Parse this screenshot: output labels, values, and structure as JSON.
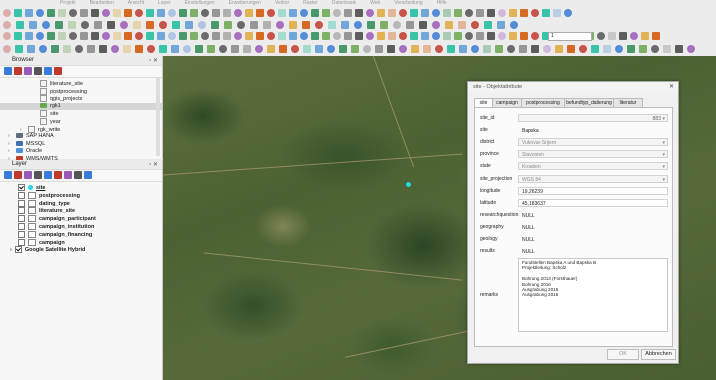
{
  "menu": [
    "Projekt",
    "Bearbeiten",
    "Ansicht",
    "Layer",
    "Einstellungen",
    "Erweiterungen",
    "Vektor",
    "Raster",
    "Datenbank",
    "Web",
    "Verarbeitung",
    "Hilfe"
  ],
  "toolbar": {
    "scale_value": "1"
  },
  "browser": {
    "title": "Browser",
    "items": [
      {
        "label": "literature_site",
        "indent": 2,
        "type": "table"
      },
      {
        "label": "postprocessing",
        "indent": 2,
        "type": "table"
      },
      {
        "label": "qgis_projects",
        "indent": 2,
        "type": "table"
      },
      {
        "label": "rgk1",
        "indent": 2,
        "type": "layer"
      },
      {
        "label": "site",
        "indent": 2,
        "type": "table"
      },
      {
        "label": "year",
        "indent": 2,
        "type": "table"
      },
      {
        "label": "rgk_write",
        "indent": 1,
        "type": "schema"
      },
      {
        "label": "SAP HANA",
        "indent": 0,
        "type": "db"
      },
      {
        "label": "MSSQL",
        "indent": 0,
        "type": "db"
      },
      {
        "label": "Oracle",
        "indent": 0,
        "type": "db"
      },
      {
        "label": "WMS/WMTS",
        "indent": 0,
        "type": "db"
      }
    ]
  },
  "layers": {
    "title": "Layer",
    "items": [
      {
        "label": "site",
        "checked": true,
        "highlight": true
      },
      {
        "label": "postprocessing",
        "checked": false
      },
      {
        "label": "dating_type",
        "checked": false
      },
      {
        "label": "literature_site",
        "checked": false
      },
      {
        "label": "campaign_participant",
        "checked": false
      },
      {
        "label": "campaign_institution",
        "checked": false
      },
      {
        "label": "campaign_financing",
        "checked": false
      },
      {
        "label": "campaign",
        "checked": false
      },
      {
        "label": "Google Satellite Hybrid",
        "checked": true
      }
    ]
  },
  "dialog": {
    "title": "site - Objektattribute",
    "tabs": [
      "site",
      "campaign",
      "postprocessing",
      "befundtyp_datierung",
      "literatur"
    ],
    "fields": [
      {
        "label": "site_id",
        "value": "",
        "id_value": "883",
        "kind": "ro"
      },
      {
        "label": "site",
        "value": "Bapska",
        "kind": "plain"
      },
      {
        "label": "district",
        "value": "Vukovar-Srijem",
        "kind": "combo"
      },
      {
        "label": "province",
        "value": "Slavonien",
        "kind": "combo"
      },
      {
        "label": "state",
        "value": "Kroatien",
        "kind": "combo"
      },
      {
        "label": "site_projection",
        "value": "WGS 84",
        "kind": "combo"
      },
      {
        "label": "longitude",
        "value": "19,26239",
        "kind": "text"
      },
      {
        "label": "latitude",
        "value": "45,183637",
        "kind": "text"
      },
      {
        "label": "researchquestion",
        "value": "NULL",
        "kind": "plain"
      },
      {
        "label": "geography",
        "value": "NULL",
        "kind": "plain"
      },
      {
        "label": "geology",
        "value": "NULL",
        "kind": "plain"
      },
      {
        "label": "results",
        "value": "NULL",
        "kind": "plain"
      }
    ],
    "remarks_label": "remarks",
    "remarks_lines": [
      "Fundstellen Bapska A und Bapska B",
      "Projektleitung: Scholz",
      "",
      "Bohrung 2013 (Forsthauer)",
      "Bohrung 2016",
      "Ausgrabung 2015",
      "Ausgrabung 2016"
    ],
    "ok_label": "OK",
    "cancel_label": "Abbrechen"
  }
}
